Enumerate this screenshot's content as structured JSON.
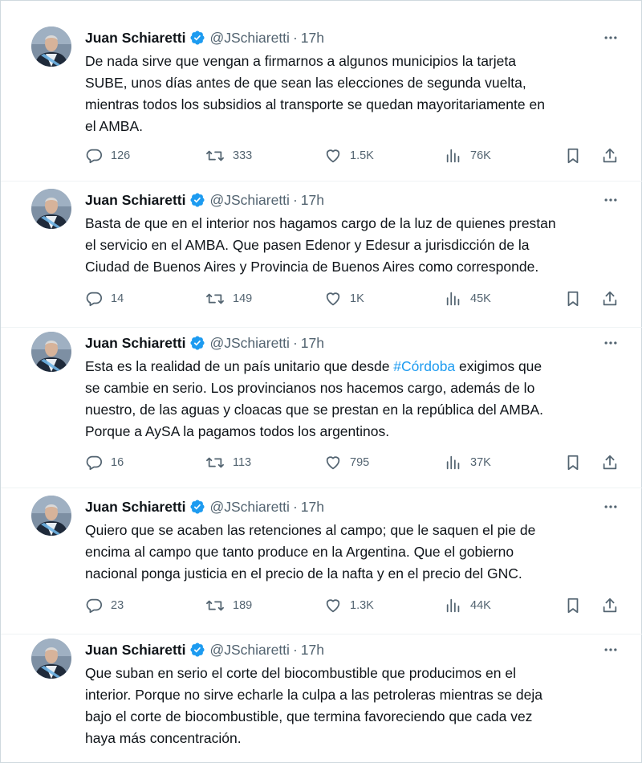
{
  "tweets": [
    {
      "author": "Juan Schiaretti",
      "handle": "@JSchiaretti",
      "separator": "·",
      "time": "17h",
      "lines": [
        "De nada sirve que vengan a firmarnos a algunos municipios la tarjeta",
        "SUBE, unos días antes de que sean las elecciones de segunda vuelta,",
        "mientras todos los subsidios al transporte se quedan mayoritariamente en",
        "el AMBA."
      ],
      "replies": "126",
      "retweets": "333",
      "likes": "1.5K",
      "views": "76K"
    },
    {
      "author": "Juan Schiaretti",
      "handle": "@JSchiaretti",
      "separator": "·",
      "time": "17h",
      "lines": [
        "Basta de que en el interior nos hagamos cargo de la luz de quienes prestan",
        "el servicio en el AMBA. Que pasen Edenor y Edesur a jurisdicción de la",
        "Ciudad de Buenos Aires y Provincia de Buenos Aires como corresponde."
      ],
      "replies": "14",
      "retweets": "149",
      "likes": "1K",
      "views": "45K"
    },
    {
      "author": "Juan Schiaretti",
      "handle": "@JSchiaretti",
      "separator": "·",
      "time": "17h",
      "line1_before": "Esta es la realidad de un país unitario que desde ",
      "hashtag": "#Córdoba",
      "line1_after": " exigimos que",
      "lines": [
        "se cambie en serio. Los provincianos nos hacemos cargo, además de lo",
        "nuestro, de las aguas y cloacas que se prestan en la república del AMBA.",
        "Porque a AySA la pagamos todos los argentinos."
      ],
      "replies": "16",
      "retweets": "113",
      "likes": "795",
      "views": "37K"
    },
    {
      "author": "Juan Schiaretti",
      "handle": "@JSchiaretti",
      "separator": "·",
      "time": "17h",
      "lines": [
        "Quiero que se acaben las retenciones al campo; que le saquen el pie de",
        "encima al campo que tanto produce en la Argentina. Que el gobierno",
        "nacional ponga justicia en el precio de la nafta y en el precio del GNC."
      ],
      "replies": "23",
      "retweets": "189",
      "likes": "1.3K",
      "views": "44K"
    },
    {
      "author": "Juan Schiaretti",
      "handle": "@JSchiaretti",
      "separator": "·",
      "time": "17h",
      "lines": [
        "Que suban en serio el corte del biocombustible que producimos en el",
        "interior. Porque no sirve echarle la culpa a las petroleras mientras se deja",
        "bajo el corte de biocombustible, que termina favoreciendo que cada vez",
        "haya más concentración."
      ]
    }
  ],
  "colors": {
    "text": "#0f1419",
    "secondary": "#536471",
    "accent": "#1d9bf0",
    "verified": "#1d9bf0"
  },
  "icons": [
    "avatar",
    "verified-badge-icon",
    "more-options-icon",
    "reply-icon",
    "retweet-icon",
    "like-icon",
    "views-icon",
    "bookmark-icon",
    "share-icon"
  ]
}
